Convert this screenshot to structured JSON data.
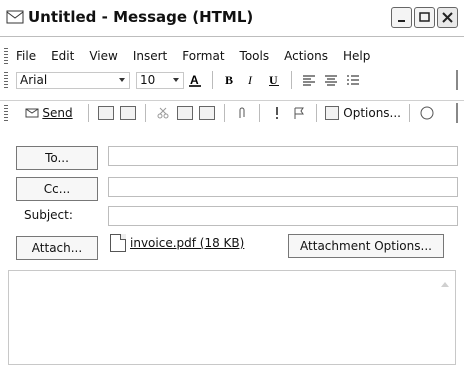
{
  "window": {
    "title": "Untitled - Message (HTML)",
    "buttons": {
      "minimize": "minimize",
      "maximize": "maximize",
      "close": "close"
    }
  },
  "menu": {
    "items": [
      "File",
      "Edit",
      "View",
      "Insert",
      "Format",
      "Tools",
      "Actions",
      "Help"
    ]
  },
  "format_toolbar": {
    "font": "Arial",
    "size": "10"
  },
  "standard_toolbar": {
    "send": "Send",
    "options": "Options..."
  },
  "fields": {
    "to_button": "To...",
    "cc_button": "Cc...",
    "subject_label": "Subject:",
    "attach_button": "Attach...",
    "attachment_name": "invoice.pdf (18 KB)",
    "attachment_options": "Attachment Options..."
  },
  "colors": {
    "border": "#777777",
    "field_border": "#bdbdbd"
  }
}
